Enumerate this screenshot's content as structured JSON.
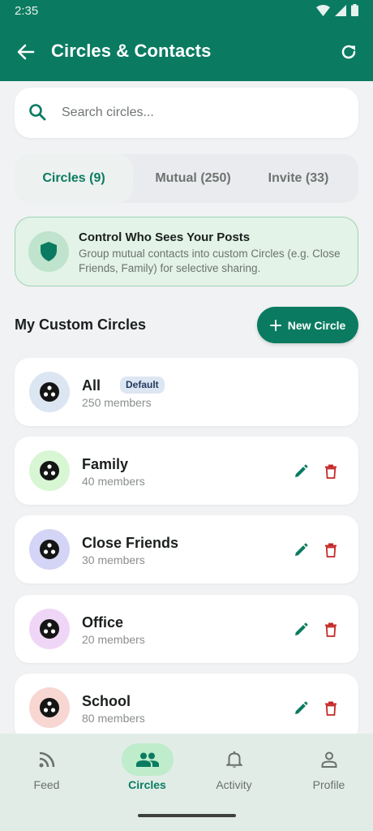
{
  "status_bar": {
    "time": "2:35"
  },
  "app_bar": {
    "title": "Circles & Contacts"
  },
  "search": {
    "placeholder": "Search circles..."
  },
  "tabs": [
    {
      "label": "Circles (9)",
      "active": true
    },
    {
      "label": "Mutual (250)",
      "active": false
    },
    {
      "label": "Invite (33)",
      "active": false
    }
  ],
  "banner": {
    "title": "Control Who Sees Your Posts",
    "text": "Group mutual contacts into custom Circles (e.g. Close Friends, Family) for selective sharing."
  },
  "section": {
    "title": "My Custom Circles",
    "new_button": "New Circle"
  },
  "circles": [
    {
      "name": "All",
      "members": "250 members",
      "badge": "Default",
      "avatar_color": "#dbe6f2",
      "editable": false
    },
    {
      "name": "Family",
      "members": "40 members",
      "avatar_color": "#d8f6d4",
      "editable": true
    },
    {
      "name": "Close Friends",
      "members": "30 members",
      "avatar_color": "#d4d4f6",
      "editable": true
    },
    {
      "name": "Office",
      "members": "20 members",
      "avatar_color": "#f0d6f6",
      "editable": true
    },
    {
      "name": "School",
      "members": "80 members",
      "avatar_color": "#f8d6d2",
      "editable": true
    }
  ],
  "bottom_nav": [
    {
      "label": "Feed",
      "icon": "rss-icon",
      "active": false
    },
    {
      "label": "Circles",
      "icon": "group-icon",
      "active": true
    },
    {
      "label": "Activity",
      "icon": "bell-icon",
      "active": false
    },
    {
      "label": "Profile",
      "icon": "person-icon",
      "active": false
    }
  ],
  "colors": {
    "primary": "#0a7b61",
    "delete": "#c62828",
    "background": "#f1f2f4"
  }
}
